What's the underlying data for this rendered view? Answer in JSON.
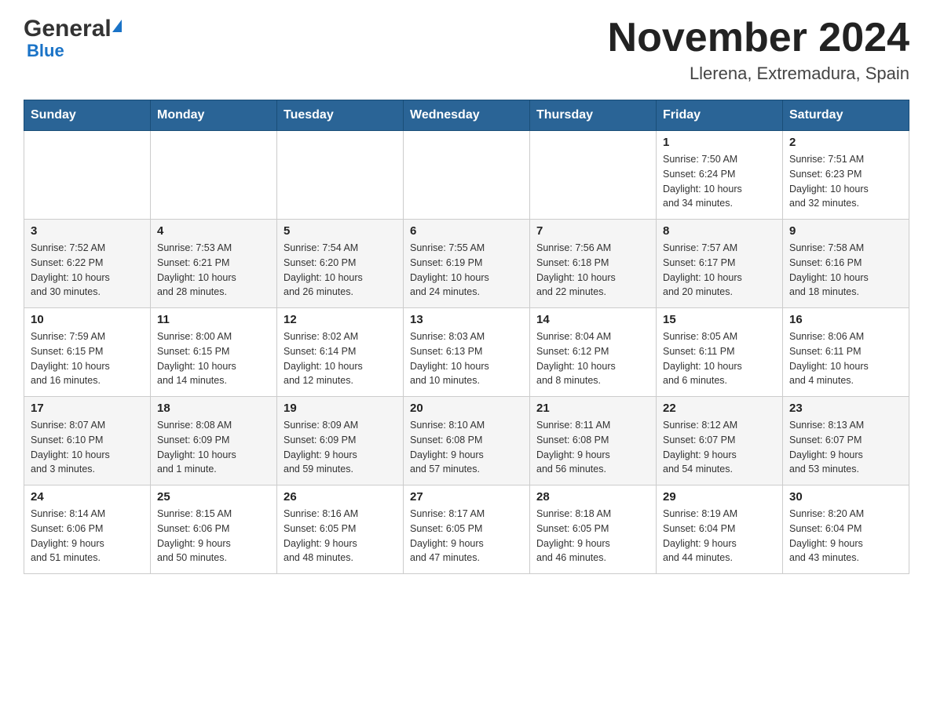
{
  "header": {
    "logo_general": "General",
    "logo_blue": "Blue",
    "month_title": "November 2024",
    "location": "Llerena, Extremadura, Spain"
  },
  "weekdays": [
    "Sunday",
    "Monday",
    "Tuesday",
    "Wednesday",
    "Thursday",
    "Friday",
    "Saturday"
  ],
  "weeks": [
    [
      {
        "day": "",
        "info": ""
      },
      {
        "day": "",
        "info": ""
      },
      {
        "day": "",
        "info": ""
      },
      {
        "day": "",
        "info": ""
      },
      {
        "day": "",
        "info": ""
      },
      {
        "day": "1",
        "info": "Sunrise: 7:50 AM\nSunset: 6:24 PM\nDaylight: 10 hours\nand 34 minutes."
      },
      {
        "day": "2",
        "info": "Sunrise: 7:51 AM\nSunset: 6:23 PM\nDaylight: 10 hours\nand 32 minutes."
      }
    ],
    [
      {
        "day": "3",
        "info": "Sunrise: 7:52 AM\nSunset: 6:22 PM\nDaylight: 10 hours\nand 30 minutes."
      },
      {
        "day": "4",
        "info": "Sunrise: 7:53 AM\nSunset: 6:21 PM\nDaylight: 10 hours\nand 28 minutes."
      },
      {
        "day": "5",
        "info": "Sunrise: 7:54 AM\nSunset: 6:20 PM\nDaylight: 10 hours\nand 26 minutes."
      },
      {
        "day": "6",
        "info": "Sunrise: 7:55 AM\nSunset: 6:19 PM\nDaylight: 10 hours\nand 24 minutes."
      },
      {
        "day": "7",
        "info": "Sunrise: 7:56 AM\nSunset: 6:18 PM\nDaylight: 10 hours\nand 22 minutes."
      },
      {
        "day": "8",
        "info": "Sunrise: 7:57 AM\nSunset: 6:17 PM\nDaylight: 10 hours\nand 20 minutes."
      },
      {
        "day": "9",
        "info": "Sunrise: 7:58 AM\nSunset: 6:16 PM\nDaylight: 10 hours\nand 18 minutes."
      }
    ],
    [
      {
        "day": "10",
        "info": "Sunrise: 7:59 AM\nSunset: 6:15 PM\nDaylight: 10 hours\nand 16 minutes."
      },
      {
        "day": "11",
        "info": "Sunrise: 8:00 AM\nSunset: 6:15 PM\nDaylight: 10 hours\nand 14 minutes."
      },
      {
        "day": "12",
        "info": "Sunrise: 8:02 AM\nSunset: 6:14 PM\nDaylight: 10 hours\nand 12 minutes."
      },
      {
        "day": "13",
        "info": "Sunrise: 8:03 AM\nSunset: 6:13 PM\nDaylight: 10 hours\nand 10 minutes."
      },
      {
        "day": "14",
        "info": "Sunrise: 8:04 AM\nSunset: 6:12 PM\nDaylight: 10 hours\nand 8 minutes."
      },
      {
        "day": "15",
        "info": "Sunrise: 8:05 AM\nSunset: 6:11 PM\nDaylight: 10 hours\nand 6 minutes."
      },
      {
        "day": "16",
        "info": "Sunrise: 8:06 AM\nSunset: 6:11 PM\nDaylight: 10 hours\nand 4 minutes."
      }
    ],
    [
      {
        "day": "17",
        "info": "Sunrise: 8:07 AM\nSunset: 6:10 PM\nDaylight: 10 hours\nand 3 minutes."
      },
      {
        "day": "18",
        "info": "Sunrise: 8:08 AM\nSunset: 6:09 PM\nDaylight: 10 hours\nand 1 minute."
      },
      {
        "day": "19",
        "info": "Sunrise: 8:09 AM\nSunset: 6:09 PM\nDaylight: 9 hours\nand 59 minutes."
      },
      {
        "day": "20",
        "info": "Sunrise: 8:10 AM\nSunset: 6:08 PM\nDaylight: 9 hours\nand 57 minutes."
      },
      {
        "day": "21",
        "info": "Sunrise: 8:11 AM\nSunset: 6:08 PM\nDaylight: 9 hours\nand 56 minutes."
      },
      {
        "day": "22",
        "info": "Sunrise: 8:12 AM\nSunset: 6:07 PM\nDaylight: 9 hours\nand 54 minutes."
      },
      {
        "day": "23",
        "info": "Sunrise: 8:13 AM\nSunset: 6:07 PM\nDaylight: 9 hours\nand 53 minutes."
      }
    ],
    [
      {
        "day": "24",
        "info": "Sunrise: 8:14 AM\nSunset: 6:06 PM\nDaylight: 9 hours\nand 51 minutes."
      },
      {
        "day": "25",
        "info": "Sunrise: 8:15 AM\nSunset: 6:06 PM\nDaylight: 9 hours\nand 50 minutes."
      },
      {
        "day": "26",
        "info": "Sunrise: 8:16 AM\nSunset: 6:05 PM\nDaylight: 9 hours\nand 48 minutes."
      },
      {
        "day": "27",
        "info": "Sunrise: 8:17 AM\nSunset: 6:05 PM\nDaylight: 9 hours\nand 47 minutes."
      },
      {
        "day": "28",
        "info": "Sunrise: 8:18 AM\nSunset: 6:05 PM\nDaylight: 9 hours\nand 46 minutes."
      },
      {
        "day": "29",
        "info": "Sunrise: 8:19 AM\nSunset: 6:04 PM\nDaylight: 9 hours\nand 44 minutes."
      },
      {
        "day": "30",
        "info": "Sunrise: 8:20 AM\nSunset: 6:04 PM\nDaylight: 9 hours\nand 43 minutes."
      }
    ]
  ]
}
